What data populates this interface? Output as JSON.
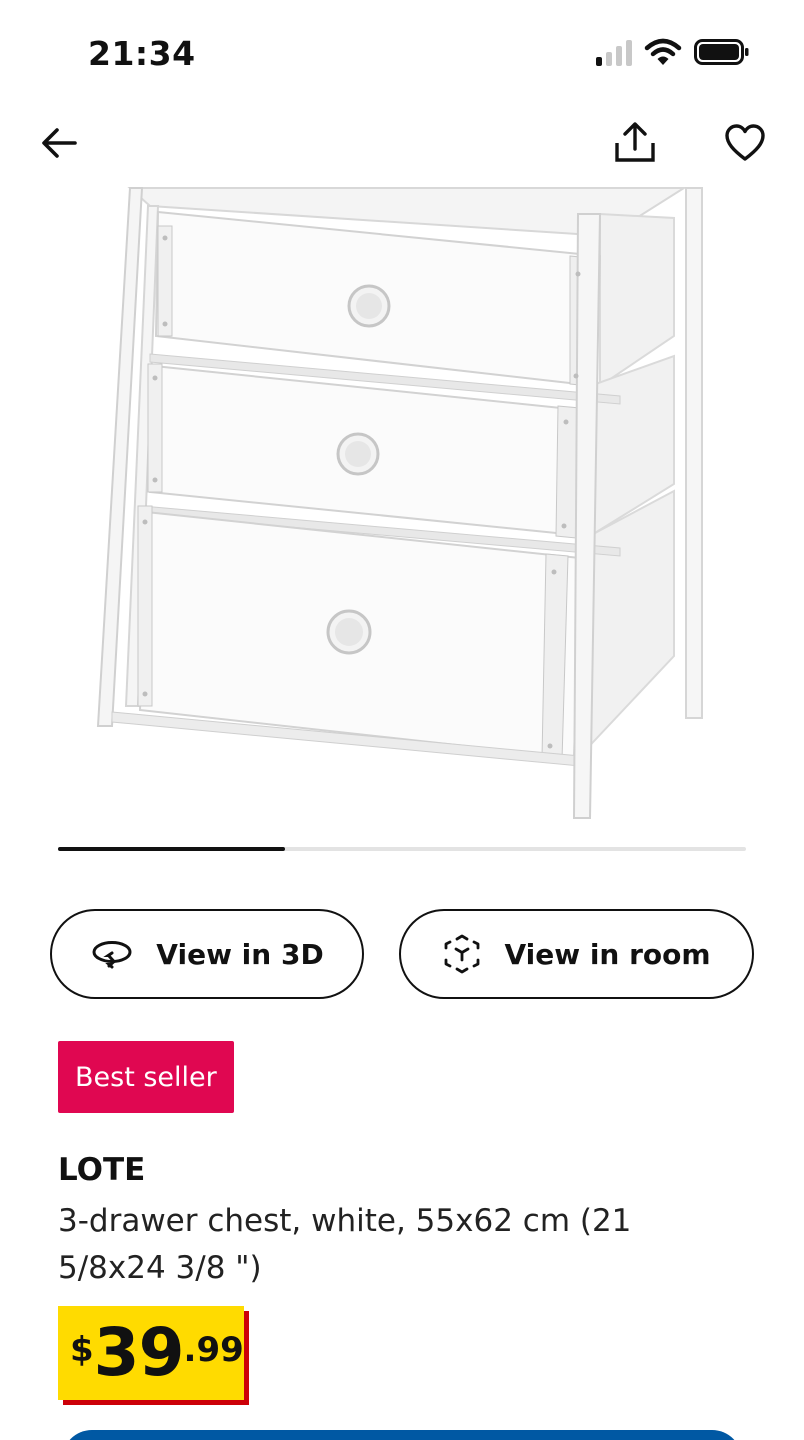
{
  "status_bar": {
    "time": "21:34",
    "signal_bars": 4,
    "signal_bars_on": 1,
    "icons": [
      "signal-icon",
      "wifi-icon",
      "battery-icon"
    ]
  },
  "nav": {
    "icons": [
      "back-arrow-icon",
      "share-icon",
      "heart-icon"
    ]
  },
  "gallery": {
    "image": "white 3-drawer chest",
    "progress_fraction": 0.33
  },
  "actions": {
    "view_3d_label": "View in 3D",
    "view_3d_icon": "rotate-3d-icon",
    "view_room_label": "View in room",
    "view_room_icon": "ar-cube-icon"
  },
  "product": {
    "badge": "Best seller",
    "name": "LOTE",
    "description": "3-drawer chest, white, 55x62 cm (21 5/8x24 3/8 \")",
    "price": {
      "currency": "$",
      "integer": "39",
      "decimal": ".99"
    }
  },
  "colors": {
    "badge_bg": "#e00751",
    "price_bg": "#ffdb00",
    "price_shadow": "#cc0008",
    "cta_blue": "#0058a3",
    "text": "#111111"
  }
}
